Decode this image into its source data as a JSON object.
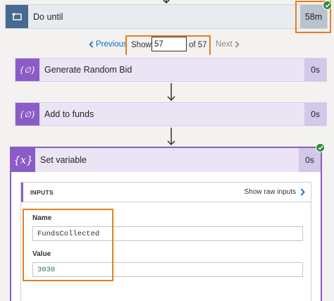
{
  "do_until": {
    "title": "Do until",
    "duration": "58m"
  },
  "pager": {
    "prev_label": "Previous",
    "show_label": "Show",
    "current": "57",
    "of_label": "of 57",
    "next_label": "Next"
  },
  "actions": [
    {
      "title": "Generate Random Bid",
      "icon": "{∅}",
      "duration": "0s"
    },
    {
      "title": "Add to funds",
      "icon": "{∅}",
      "duration": "0s"
    }
  ],
  "set_variable": {
    "title": "Set variable",
    "icon": "{x}",
    "duration": "0s",
    "inputs_label": "INPUTS",
    "show_raw_label": "Show raw inputs",
    "name_label": "Name",
    "name_value": "FundsCollected",
    "value_label": "Value",
    "value_value": "3030"
  },
  "colors": {
    "highlight": "#e87e24",
    "loop_blue": "#486991",
    "action_purple": "#8b5cc7",
    "success_green": "#2e8b3a",
    "link_blue": "#0f6cbd",
    "value_green": "#1e7d4a"
  }
}
